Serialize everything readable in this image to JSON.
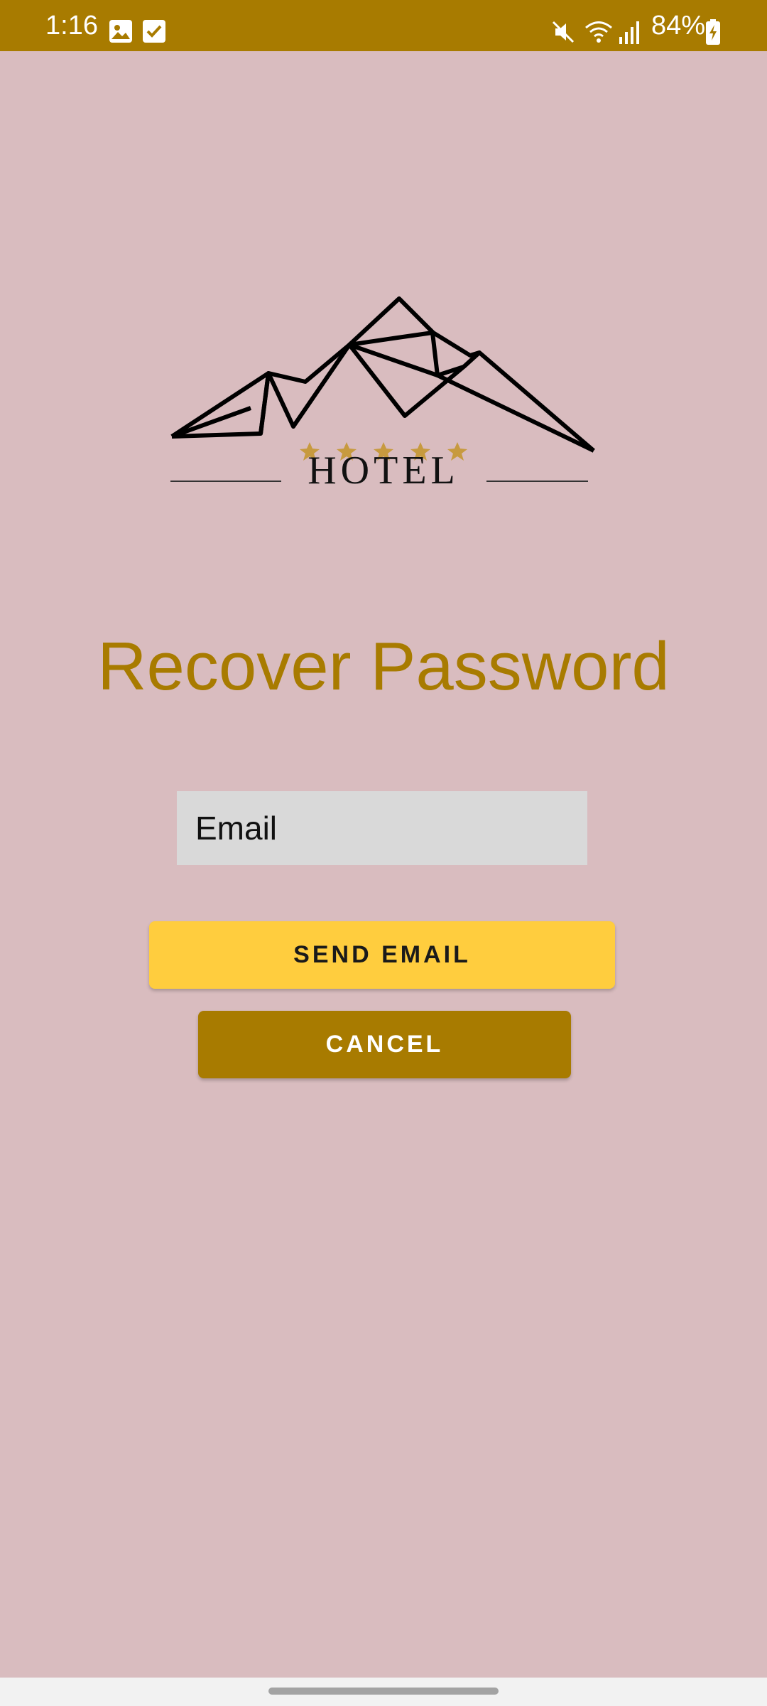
{
  "colors": {
    "status_bar": "#a87b00",
    "background": "#d9bcbf",
    "title": "#a87b00",
    "send_button": "#ffcd3e",
    "cancel_button": "#a87b00",
    "logo_stars": "#c79a3f",
    "nav_bar": "#f2f2f2"
  },
  "status_bar": {
    "time": "1:16",
    "battery": "84%",
    "icons": [
      "image-icon",
      "checkbox-icon",
      "mute-icon",
      "wifi-icon",
      "signal-icon",
      "battery-charging-icon"
    ]
  },
  "logo": {
    "text": "HOTEL",
    "stars": 5
  },
  "title": "Recover Password",
  "email_field": {
    "placeholder": "Email",
    "value": ""
  },
  "send_button": {
    "label": "SEND EMAIL"
  },
  "cancel_button": {
    "label": "CANCEL"
  }
}
